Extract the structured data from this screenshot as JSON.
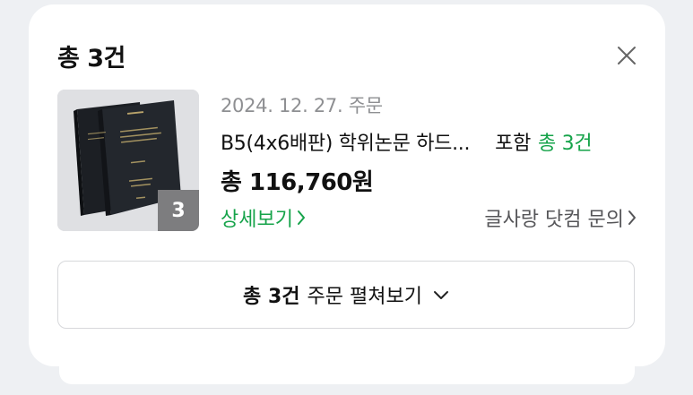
{
  "header": {
    "title": "총 3건"
  },
  "order": {
    "date": "2024. 12. 27. 주문",
    "product_name": "B5(4x6배판) 학위논문 하드...",
    "product_suffix": "포함",
    "product_count": "총 3건",
    "total_price": "총 116,760원",
    "thumb_count": "3",
    "detail_link": "상세보기",
    "contact_link": "글사랑 닷컴 문의"
  },
  "expand": {
    "bold": "총 3건",
    "label": "주문 펼쳐보기"
  },
  "colors": {
    "accent_green": "#16a34a",
    "muted_text": "#8e8f92",
    "background": "#eef0f3"
  },
  "icons": {
    "close": "close-icon",
    "chevron_right": "chevron-right-icon",
    "chevron_down": "chevron-down-icon"
  }
}
